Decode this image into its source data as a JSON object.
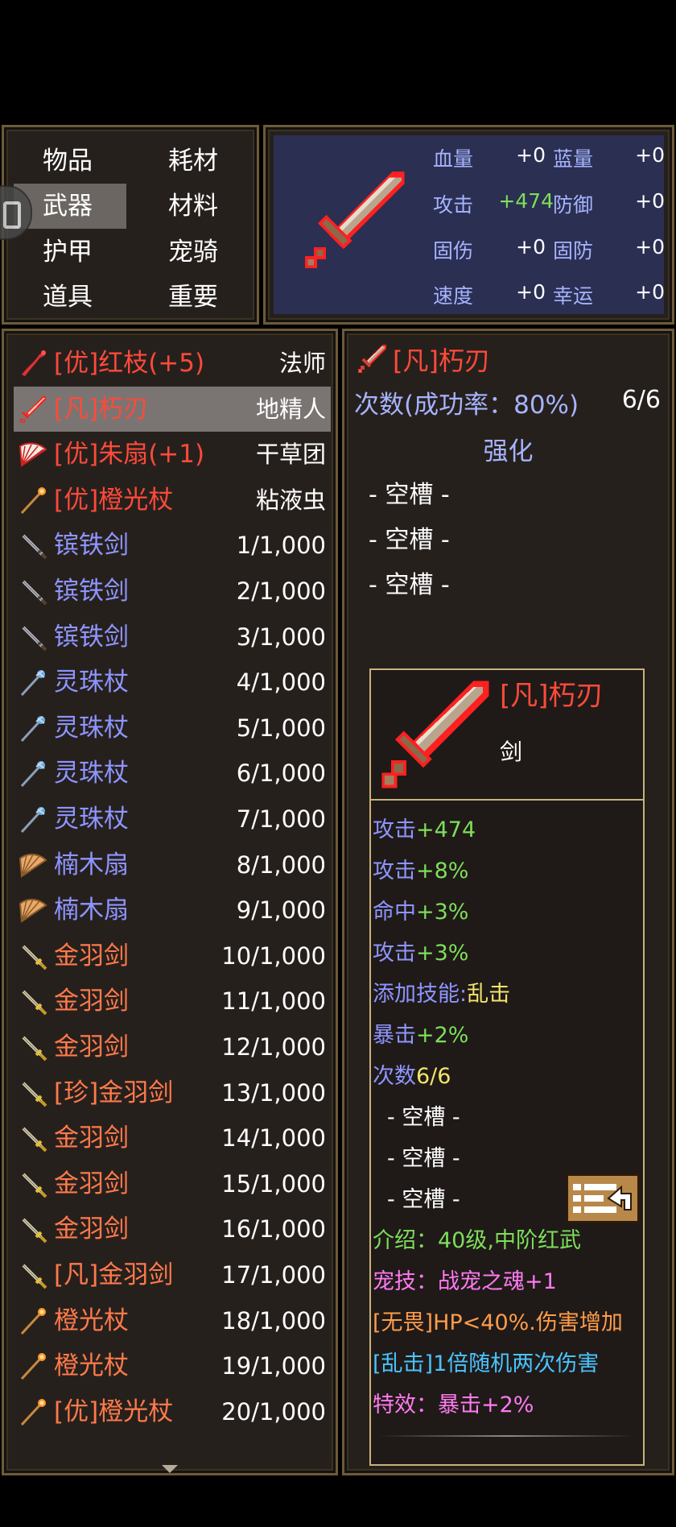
{
  "categories": [
    {
      "label": "物品",
      "selected": false
    },
    {
      "label": "耗材",
      "selected": false
    },
    {
      "label": "武器",
      "selected": true
    },
    {
      "label": "材料",
      "selected": false
    },
    {
      "label": "护甲",
      "selected": false
    },
    {
      "label": "宠骑",
      "selected": false
    },
    {
      "label": "道具",
      "selected": false
    },
    {
      "label": "重要",
      "selected": false
    }
  ],
  "stats": {
    "hp": {
      "label": "血量",
      "value": "+0"
    },
    "mp": {
      "label": "蓝量",
      "value": "+0"
    },
    "atk": {
      "label": "攻击",
      "value": "+474"
    },
    "def": {
      "label": "防御",
      "value": "+0"
    },
    "fdmg": {
      "label": "固伤",
      "value": "+0"
    },
    "fdef": {
      "label": "固防",
      "value": "+0"
    },
    "spd": {
      "label": "速度",
      "value": "+0"
    },
    "luck": {
      "label": "幸运",
      "value": "+0"
    }
  },
  "items": [
    {
      "name": "[优]红枝(+5)",
      "value": "法师",
      "icon": "red-branch",
      "color": "#ff4a3a",
      "selected": false
    },
    {
      "name": "[凡]朽刃",
      "value": "地精人",
      "icon": "sword",
      "color": "#ff4a3a",
      "selected": true
    },
    {
      "name": "[优]朱扇(+1)",
      "value": "干草团",
      "icon": "fan",
      "color": "#ff4a3a",
      "selected": false
    },
    {
      "name": "[优]橙光杖",
      "value": "粘液虫",
      "icon": "orange-staff",
      "color": "#ff4a3a",
      "selected": false
    },
    {
      "name": "镔铁剑",
      "value": "1/1,000",
      "icon": "iron-sword",
      "color": "#8e95ff",
      "selected": false
    },
    {
      "name": "镔铁剑",
      "value": "2/1,000",
      "icon": "iron-sword",
      "color": "#8e95ff",
      "selected": false
    },
    {
      "name": "镔铁剑",
      "value": "3/1,000",
      "icon": "iron-sword",
      "color": "#8e95ff",
      "selected": false
    },
    {
      "name": "灵珠杖",
      "value": "4/1,000",
      "icon": "pearl-staff",
      "color": "#8e95ff",
      "selected": false
    },
    {
      "name": "灵珠杖",
      "value": "5/1,000",
      "icon": "pearl-staff",
      "color": "#8e95ff",
      "selected": false
    },
    {
      "name": "灵珠杖",
      "value": "6/1,000",
      "icon": "pearl-staff",
      "color": "#8e95ff",
      "selected": false
    },
    {
      "name": "灵珠杖",
      "value": "7/1,000",
      "icon": "pearl-staff",
      "color": "#8e95ff",
      "selected": false
    },
    {
      "name": "楠木扇",
      "value": "8/1,000",
      "icon": "wood-fan",
      "color": "#8e95ff",
      "selected": false
    },
    {
      "name": "楠木扇",
      "value": "9/1,000",
      "icon": "wood-fan",
      "color": "#8e95ff",
      "selected": false
    },
    {
      "name": "金羽剑",
      "value": "10/1,000",
      "icon": "gold-sword",
      "color": "#ff7a4a",
      "selected": false
    },
    {
      "name": "金羽剑",
      "value": "11/1,000",
      "icon": "gold-sword",
      "color": "#ff7a4a",
      "selected": false
    },
    {
      "name": "金羽剑",
      "value": "12/1,000",
      "icon": "gold-sword",
      "color": "#ff7a4a",
      "selected": false
    },
    {
      "name": "[珍]金羽剑",
      "value": "13/1,000",
      "icon": "gold-sword",
      "color": "#ff7a4a",
      "selected": false
    },
    {
      "name": "金羽剑",
      "value": "14/1,000",
      "icon": "gold-sword",
      "color": "#ff7a4a",
      "selected": false
    },
    {
      "name": "金羽剑",
      "value": "15/1,000",
      "icon": "gold-sword",
      "color": "#ff7a4a",
      "selected": false
    },
    {
      "name": "金羽剑",
      "value": "16/1,000",
      "icon": "gold-sword",
      "color": "#ff7a4a",
      "selected": false
    },
    {
      "name": "[凡]金羽剑",
      "value": "17/1,000",
      "icon": "gold-sword",
      "color": "#ff7a4a",
      "selected": false
    },
    {
      "name": "橙光杖",
      "value": "18/1,000",
      "icon": "orange-staff",
      "color": "#ff7a4a",
      "selected": false
    },
    {
      "name": "橙光杖",
      "value": "19/1,000",
      "icon": "orange-staff",
      "color": "#ff7a4a",
      "selected": false
    },
    {
      "name": "[优]橙光杖",
      "value": "20/1,000",
      "icon": "orange-staff",
      "color": "#ff7a4a",
      "selected": false
    }
  ],
  "detail": {
    "name": "[凡]朽刃",
    "count_label": "次数(成功率：80%)",
    "count_value": "6/6",
    "enhance_label": "强化",
    "slots": [
      "- 空槽 -",
      "- 空槽 -",
      "- 空槽 -"
    ],
    "tooltip": {
      "name": "[凡]朽刃",
      "type": "剑",
      "lines": [
        {
          "label": "攻击",
          "value": "+474"
        },
        {
          "label": "攻击",
          "value": "+8%"
        },
        {
          "label": "命中",
          "value": "+3%"
        },
        {
          "label": "攻击",
          "value": "+3%"
        },
        {
          "label": "添加技能:",
          "value": "乱击"
        },
        {
          "label": "暴击",
          "value": "+2%"
        },
        {
          "label": "次数",
          "value": "6/6"
        }
      ],
      "slots": [
        "- 空槽 -",
        "- 空槽 -",
        "- 空槽 -"
      ],
      "intro": "介绍：40级,中阶红武",
      "pet_skill": "宠技：战宠之魂+1",
      "fearless": "[无畏]HP<40%.伤害增加",
      "chaos": "[乱击]1倍随机两次伤害",
      "effect": "特效：暴击+2%"
    }
  }
}
